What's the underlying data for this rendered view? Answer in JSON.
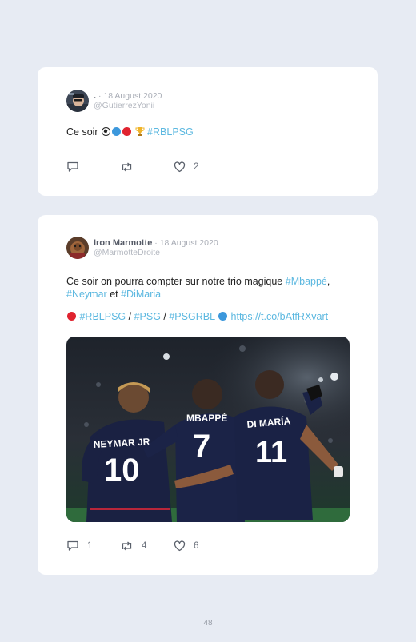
{
  "tweets": [
    {
      "author_name": ".",
      "separator": " · ",
      "date": "18 August 2020",
      "handle": "@GutierrezYonii",
      "text_prefix": "Ce soir",
      "hashtag": "#RBLPSG",
      "actions": {
        "reply_count": "",
        "retweet_count": "",
        "like_count": "2"
      }
    },
    {
      "author_name": "Iron Marmotte",
      "separator": " · ",
      "date": "18 August 2020",
      "handle": "@MarmotteDroite",
      "line1_text": "Ce soir on pourra compter sur notre trio magique ",
      "tag_mbappe": "#Mbappé",
      "comma": ",",
      "tag_neymar": "#Neymar",
      "and_text": " et ",
      "tag_dimaria": "#DiMaria",
      "tag_rblpsg": "#RBLPSG",
      "slash1": " / ",
      "tag_psg": "#PSG",
      "slash2": " / ",
      "tag_psgrbl": "#PSGRBL",
      "link": "https://t.co/bAtfRXvart",
      "image_text": {
        "player_left_name": "NEYMAR JR",
        "player_left_number": "10",
        "player_mid_name": "MBAPPÉ",
        "player_mid_number": "7",
        "player_right_name": "DI MARÍA",
        "player_right_number": "11"
      },
      "actions": {
        "reply_count": "1",
        "retweet_count": "4",
        "like_count": "6"
      }
    }
  ],
  "page_number": "48",
  "colors": {
    "hashtag": "#5cb8e0",
    "background": "#e7ebf3",
    "red_dot": "#e0232f",
    "blue_dot": "#3c98dc"
  },
  "icons": [
    "reply-icon",
    "retweet-icon",
    "like-icon",
    "soccer-ball-icon",
    "trophy-icon"
  ]
}
